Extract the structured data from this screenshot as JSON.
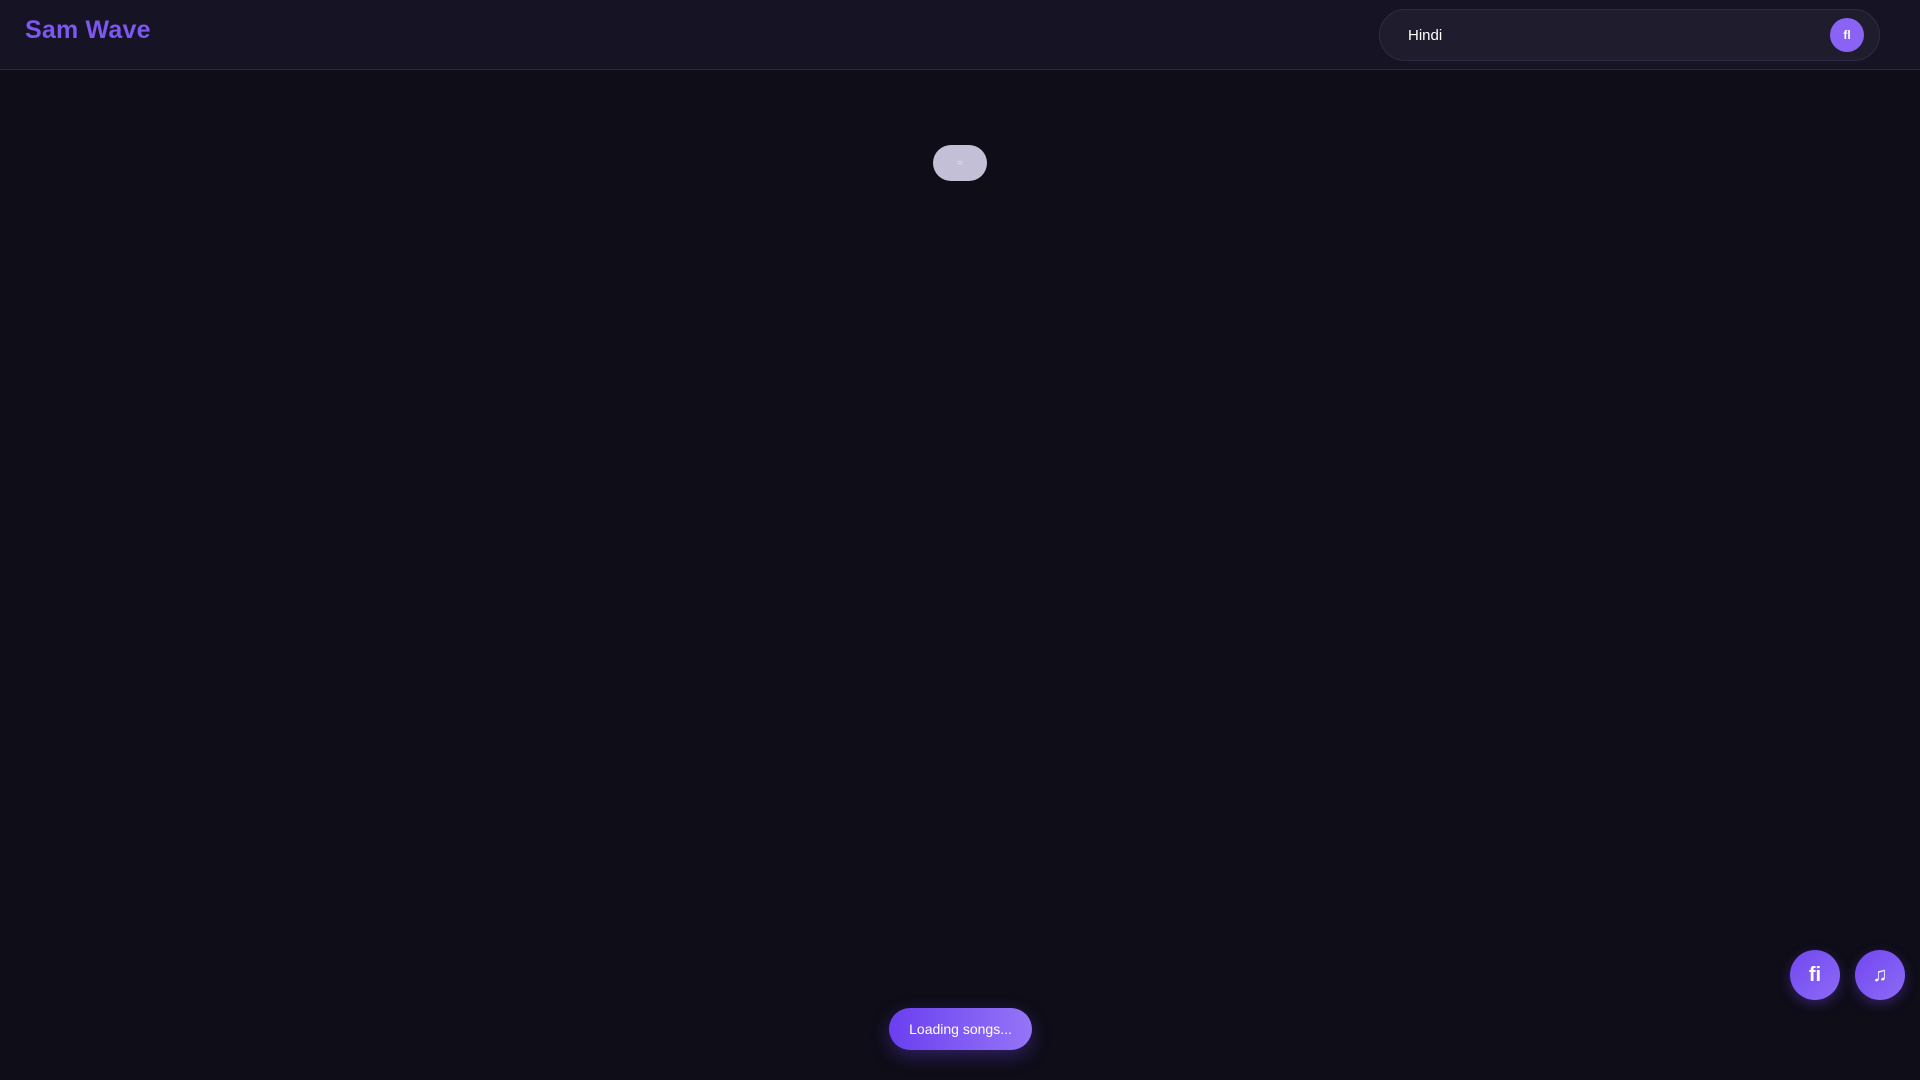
{
  "app": {
    "brand": "Sam Wave"
  },
  "search": {
    "value": "Hindi",
    "button_glyph": "fl",
    "button_icon": "search-icon"
  },
  "loader": {
    "glyph": "≈",
    "icon": "loading-pill-icon"
  },
  "fabs": {
    "left_glyph": "fi",
    "left_icon": "queue-icon",
    "right_glyph": "♫",
    "right_icon": "music-icon"
  },
  "toast": {
    "message": "Loading songs..."
  },
  "colors": {
    "background": "#0f0d18",
    "topbar": "#161324",
    "accent": "#7c57f0"
  }
}
